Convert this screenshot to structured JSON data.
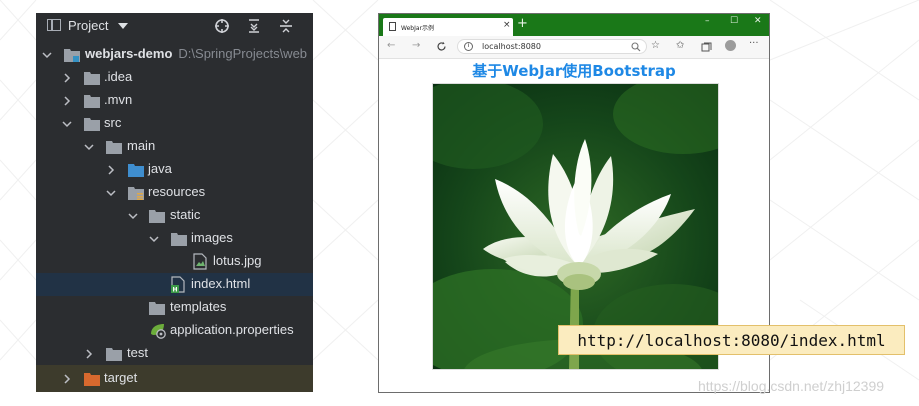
{
  "ide": {
    "panel_title": "Project",
    "project_name": "webjars-demo",
    "project_path": "D:\\SpringProjects\\web",
    "tree": [
      {
        "label": ".idea"
      },
      {
        "label": ".mvn"
      },
      {
        "label": "src"
      },
      {
        "label": "main"
      },
      {
        "label": "java"
      },
      {
        "label": "resources"
      },
      {
        "label": "static"
      },
      {
        "label": "images"
      },
      {
        "label": "lotus.jpg"
      },
      {
        "label": "index.html"
      },
      {
        "label": "templates"
      },
      {
        "label": "application.properties"
      },
      {
        "label": "test"
      },
      {
        "label": "target"
      }
    ]
  },
  "browser": {
    "tab_title": "WebJar示例",
    "new_tab": "+",
    "tab_close": "×",
    "url": "localhost:8080",
    "page_heading": "基于WebJar使用Bootstrap",
    "window_controls": [
      "–",
      "☐",
      "✕"
    ],
    "titlebar_color": "#1a7818",
    "heading_color": "#1e88e5"
  },
  "callout": {
    "text": "http://localhost:8080/index.html"
  },
  "watermark": "https://blog.csdn.net/zhj12399"
}
